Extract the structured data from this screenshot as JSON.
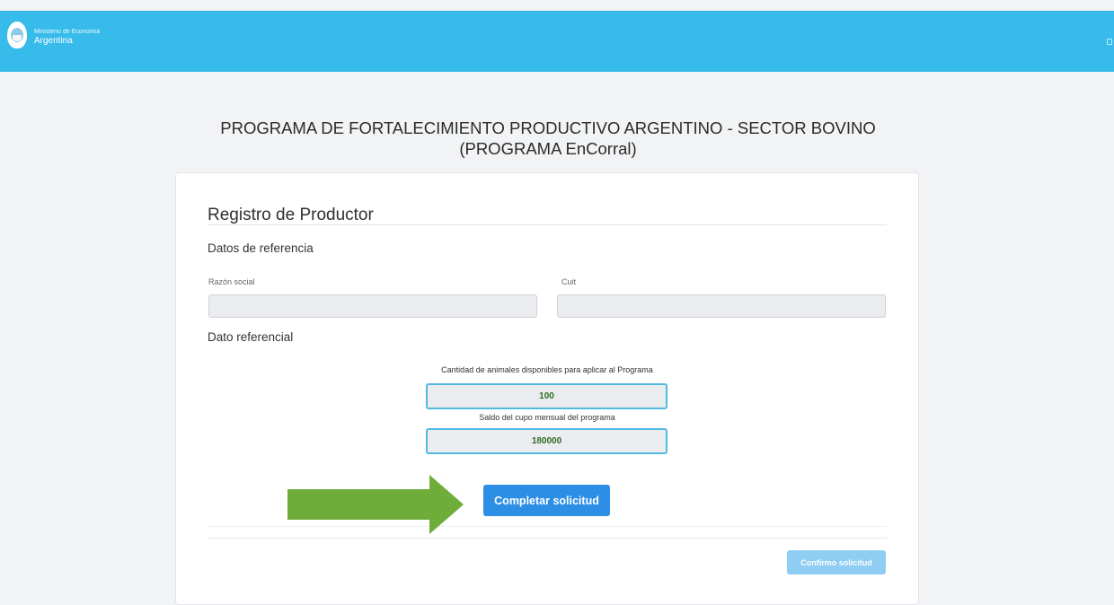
{
  "header": {
    "org_line1": "Ministerio de Economía",
    "org_line2": "Argentina",
    "color": "#37bbeb"
  },
  "page": {
    "title_line1": "PROGRAMA DE FORTALECIMIENTO PRODUCTIVO ARGENTINO - SECTOR BOVINO",
    "title_line2": "(PROGRAMA EnCorral)"
  },
  "form": {
    "title": "Registro de Productor",
    "section_referencia": "Datos de referencia",
    "razon_social_label": "Razón social",
    "razon_social_value": "",
    "cuit_label": "Cuit",
    "cuit_value": "",
    "section_dato": "Dato referencial",
    "cantidad_label": "Cantidad de animales disponibles para aplicar al Programa",
    "cantidad_value": "100",
    "saldo_label": "Saldo del cupo mensual del programa",
    "saldo_value": "180000",
    "completar_button": "Completar solicitud",
    "confirmo_button": "Confirmo solicitud"
  },
  "annotation": {
    "arrow_color": "#6fad3a",
    "arrow_direction": "right"
  },
  "colors": {
    "primary_button": "#2d8ee6",
    "disabled_button": "#8fcdf2",
    "value_text": "#2d6b1f"
  }
}
